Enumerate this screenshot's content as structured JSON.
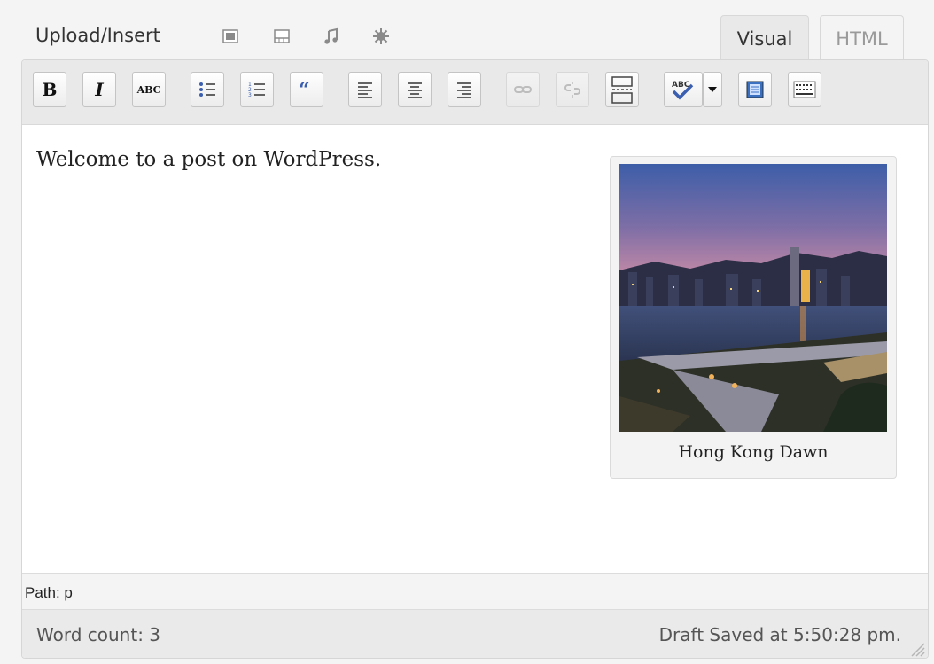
{
  "media_bar": {
    "label": "Upload/Insert",
    "icons": [
      "image-icon",
      "video-icon",
      "audio-icon",
      "media-icon"
    ]
  },
  "tabs": {
    "visual": "Visual",
    "html": "HTML"
  },
  "toolbar": {
    "buttons": [
      "bold",
      "italic",
      "strikethrough",
      "unordered-list",
      "ordered-list",
      "blockquote",
      "align-left",
      "align-center",
      "align-right",
      "insert-link",
      "unlink",
      "insert-more",
      "spellcheck",
      "spellcheck-dropdown",
      "fullscreen",
      "kitchen-sink"
    ],
    "bold_label": "B",
    "italic_label": "I",
    "strike_label": "ABC",
    "spell_label": "ABC"
  },
  "content": {
    "paragraph": "Welcome to a post on WordPress.",
    "image_caption": "Hong Kong Dawn"
  },
  "path": "Path: p",
  "status": {
    "word_count": "Word count: 3",
    "draft_saved": "Draft Saved at 5:50:28 pm."
  }
}
